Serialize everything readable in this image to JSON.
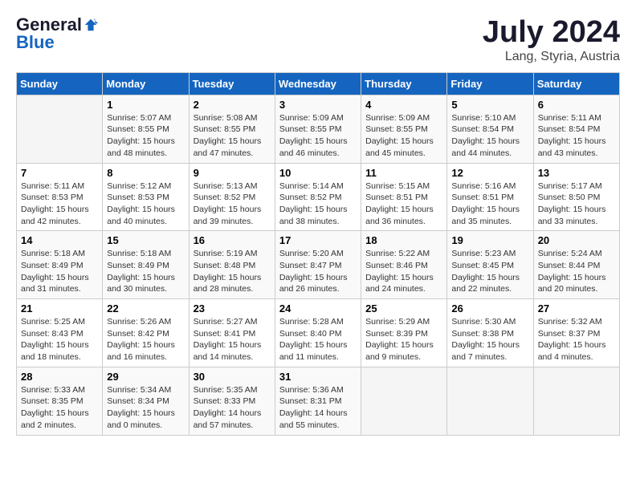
{
  "header": {
    "logo_general": "General",
    "logo_blue": "Blue",
    "title": "July 2024",
    "location": "Lang, Styria, Austria"
  },
  "calendar": {
    "columns": [
      "Sunday",
      "Monday",
      "Tuesday",
      "Wednesday",
      "Thursday",
      "Friday",
      "Saturday"
    ],
    "weeks": [
      [
        {
          "day": "",
          "info": ""
        },
        {
          "day": "1",
          "info": "Sunrise: 5:07 AM\nSunset: 8:55 PM\nDaylight: 15 hours\nand 48 minutes."
        },
        {
          "day": "2",
          "info": "Sunrise: 5:08 AM\nSunset: 8:55 PM\nDaylight: 15 hours\nand 47 minutes."
        },
        {
          "day": "3",
          "info": "Sunrise: 5:09 AM\nSunset: 8:55 PM\nDaylight: 15 hours\nand 46 minutes."
        },
        {
          "day": "4",
          "info": "Sunrise: 5:09 AM\nSunset: 8:55 PM\nDaylight: 15 hours\nand 45 minutes."
        },
        {
          "day": "5",
          "info": "Sunrise: 5:10 AM\nSunset: 8:54 PM\nDaylight: 15 hours\nand 44 minutes."
        },
        {
          "day": "6",
          "info": "Sunrise: 5:11 AM\nSunset: 8:54 PM\nDaylight: 15 hours\nand 43 minutes."
        }
      ],
      [
        {
          "day": "7",
          "info": "Sunrise: 5:11 AM\nSunset: 8:53 PM\nDaylight: 15 hours\nand 42 minutes."
        },
        {
          "day": "8",
          "info": "Sunrise: 5:12 AM\nSunset: 8:53 PM\nDaylight: 15 hours\nand 40 minutes."
        },
        {
          "day": "9",
          "info": "Sunrise: 5:13 AM\nSunset: 8:52 PM\nDaylight: 15 hours\nand 39 minutes."
        },
        {
          "day": "10",
          "info": "Sunrise: 5:14 AM\nSunset: 8:52 PM\nDaylight: 15 hours\nand 38 minutes."
        },
        {
          "day": "11",
          "info": "Sunrise: 5:15 AM\nSunset: 8:51 PM\nDaylight: 15 hours\nand 36 minutes."
        },
        {
          "day": "12",
          "info": "Sunrise: 5:16 AM\nSunset: 8:51 PM\nDaylight: 15 hours\nand 35 minutes."
        },
        {
          "day": "13",
          "info": "Sunrise: 5:17 AM\nSunset: 8:50 PM\nDaylight: 15 hours\nand 33 minutes."
        }
      ],
      [
        {
          "day": "14",
          "info": "Sunrise: 5:18 AM\nSunset: 8:49 PM\nDaylight: 15 hours\nand 31 minutes."
        },
        {
          "day": "15",
          "info": "Sunrise: 5:18 AM\nSunset: 8:49 PM\nDaylight: 15 hours\nand 30 minutes."
        },
        {
          "day": "16",
          "info": "Sunrise: 5:19 AM\nSunset: 8:48 PM\nDaylight: 15 hours\nand 28 minutes."
        },
        {
          "day": "17",
          "info": "Sunrise: 5:20 AM\nSunset: 8:47 PM\nDaylight: 15 hours\nand 26 minutes."
        },
        {
          "day": "18",
          "info": "Sunrise: 5:22 AM\nSunset: 8:46 PM\nDaylight: 15 hours\nand 24 minutes."
        },
        {
          "day": "19",
          "info": "Sunrise: 5:23 AM\nSunset: 8:45 PM\nDaylight: 15 hours\nand 22 minutes."
        },
        {
          "day": "20",
          "info": "Sunrise: 5:24 AM\nSunset: 8:44 PM\nDaylight: 15 hours\nand 20 minutes."
        }
      ],
      [
        {
          "day": "21",
          "info": "Sunrise: 5:25 AM\nSunset: 8:43 PM\nDaylight: 15 hours\nand 18 minutes."
        },
        {
          "day": "22",
          "info": "Sunrise: 5:26 AM\nSunset: 8:42 PM\nDaylight: 15 hours\nand 16 minutes."
        },
        {
          "day": "23",
          "info": "Sunrise: 5:27 AM\nSunset: 8:41 PM\nDaylight: 15 hours\nand 14 minutes."
        },
        {
          "day": "24",
          "info": "Sunrise: 5:28 AM\nSunset: 8:40 PM\nDaylight: 15 hours\nand 11 minutes."
        },
        {
          "day": "25",
          "info": "Sunrise: 5:29 AM\nSunset: 8:39 PM\nDaylight: 15 hours\nand 9 minutes."
        },
        {
          "day": "26",
          "info": "Sunrise: 5:30 AM\nSunset: 8:38 PM\nDaylight: 15 hours\nand 7 minutes."
        },
        {
          "day": "27",
          "info": "Sunrise: 5:32 AM\nSunset: 8:37 PM\nDaylight: 15 hours\nand 4 minutes."
        }
      ],
      [
        {
          "day": "28",
          "info": "Sunrise: 5:33 AM\nSunset: 8:35 PM\nDaylight: 15 hours\nand 2 minutes."
        },
        {
          "day": "29",
          "info": "Sunrise: 5:34 AM\nSunset: 8:34 PM\nDaylight: 15 hours\nand 0 minutes."
        },
        {
          "day": "30",
          "info": "Sunrise: 5:35 AM\nSunset: 8:33 PM\nDaylight: 14 hours\nand 57 minutes."
        },
        {
          "day": "31",
          "info": "Sunrise: 5:36 AM\nSunset: 8:31 PM\nDaylight: 14 hours\nand 55 minutes."
        },
        {
          "day": "",
          "info": ""
        },
        {
          "day": "",
          "info": ""
        },
        {
          "day": "",
          "info": ""
        }
      ]
    ]
  }
}
